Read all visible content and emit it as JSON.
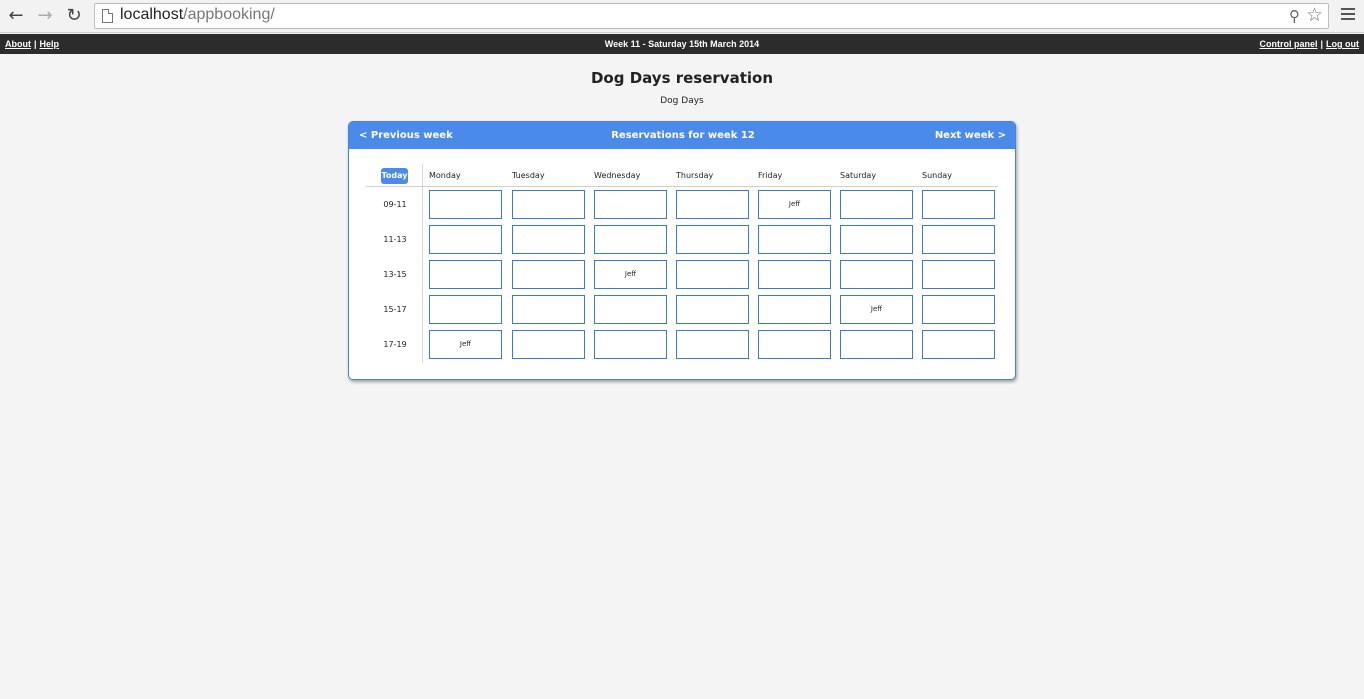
{
  "browser": {
    "url_host": "localhost",
    "url_path": "/appbooking/"
  },
  "topbar": {
    "about": "About",
    "help": "Help",
    "center": "Week 11 - Saturday 15th March 2014",
    "control_panel": "Control panel",
    "logout": "Log out"
  },
  "page": {
    "title": "Dog Days reservation",
    "subtitle": "Dog Days"
  },
  "panel": {
    "prev": "< Previous week",
    "heading": "Reservations for week 12",
    "next": "Next week >",
    "today": "Today"
  },
  "days": [
    "Monday",
    "Tuesday",
    "Wednesday",
    "Thursday",
    "Friday",
    "Saturday",
    "Sunday"
  ],
  "times": [
    "09-11",
    "11-13",
    "13-15",
    "15-17",
    "17-19"
  ],
  "slots": [
    [
      "",
      "",
      "",
      "",
      "Jeff",
      "",
      ""
    ],
    [
      "",
      "",
      "",
      "",
      "",
      "",
      ""
    ],
    [
      "",
      "",
      "Jeff",
      "",
      "",
      "",
      ""
    ],
    [
      "",
      "",
      "",
      "",
      "",
      "Jeff",
      ""
    ],
    [
      "Jeff",
      "",
      "",
      "",
      "",
      "",
      ""
    ]
  ]
}
